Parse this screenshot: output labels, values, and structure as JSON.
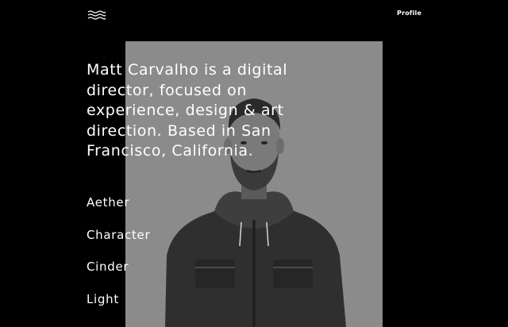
{
  "header": {
    "logo_icon": "wave-logo-icon",
    "profile_label": "Profile"
  },
  "intro": {
    "text": "Matt Carvalho is a digital director, focused on experience, design & art direction. Based in San Francisco, California."
  },
  "projects": [
    {
      "label": "Aether"
    },
    {
      "label": "Character"
    },
    {
      "label": "Cinder"
    },
    {
      "label": "Light"
    }
  ],
  "colors": {
    "background": "#000000",
    "text": "#ffffff",
    "portrait_panel": "#8b8b8b"
  }
}
